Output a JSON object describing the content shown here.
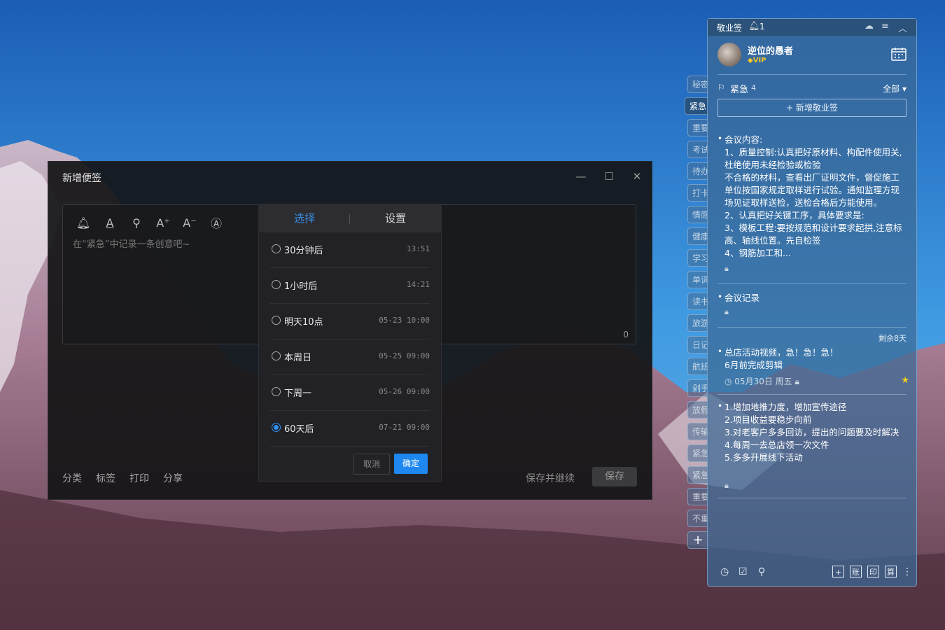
{
  "editor": {
    "title": "新增便签",
    "placeholder": "在“紧急”中记录一条创意吧~",
    "char_count": "0",
    "bottom_links": [
      "分类",
      "标签",
      "打印",
      "分享"
    ],
    "save_continue_label": "保存并继续",
    "save_label": "保存"
  },
  "reminder": {
    "tabs": [
      "选择",
      "设置"
    ],
    "options": [
      {
        "label": "30分钟后",
        "time": "13:51",
        "checked": false
      },
      {
        "label": "1小时后",
        "time": "14:21",
        "checked": false
      },
      {
        "label": "明天10点",
        "time": "05-23 10:00",
        "checked": false
      },
      {
        "label": "本周日",
        "time": "05-25 09:00",
        "checked": false
      },
      {
        "label": "下周一",
        "time": "05-26 09:00",
        "checked": false
      },
      {
        "label": "60天后",
        "time": "07-21 09:00",
        "checked": true
      }
    ],
    "cancel_label": "取消",
    "ok_label": "确定"
  },
  "side_tabs": [
    "秘密",
    "紧急",
    "重要",
    "考试",
    "待办",
    "打卡",
    "情感",
    "健康",
    "学习",
    "单词",
    "读书",
    "旅游",
    "日记",
    "航班",
    "剁手",
    "放假",
    "传输",
    "紧急",
    "紧急",
    "重要",
    "不重"
  ],
  "side_active_index": 1,
  "panel": {
    "app_title": "敬业签",
    "bell_count": "1",
    "username": "逆位的愚者",
    "vip_label": "VIP",
    "category_name": "紧急",
    "category_count": "4",
    "filter_label": "全部",
    "new_note_label": "+ 新增敬业签",
    "notes": [
      {
        "text": "会议内容:\n1、质量控制:认真把好原材料、构配件使用关,杜绝使用未经检验或检验\n不合格的材料，查看出厂证明文件，督促施工单位按国家规定取样进行试验。通知监理方现场见证取样送检，送检合格后方能使用。\n2、认真把好关键工序，具体要求是:\n3、模板工程:要按规范和设计要求起拱,注意标高、轴线位置。先自检签\n4、钢筋加工和..."
      },
      {
        "text": "会议记录"
      },
      {
        "remaining": "剩余8天",
        "text": "总店活动视频，急！急！急！\n6月前完成剪辑",
        "date": "05月30日 周五"
      },
      {
        "text": "1.增加地推力度，增加宣传途径\n2.项目收益要稳步向前\n3.对老客户多多回访，提出的问题要及时解决\n4.每周一去总店领一次文件\n5.多多开展线下活动"
      }
    ],
    "footer_boxes": [
      "账",
      "印",
      "算"
    ]
  },
  "colors": {
    "accent": "#1e88f0",
    "vip": "#f4c623",
    "star": "#f5d21a"
  }
}
